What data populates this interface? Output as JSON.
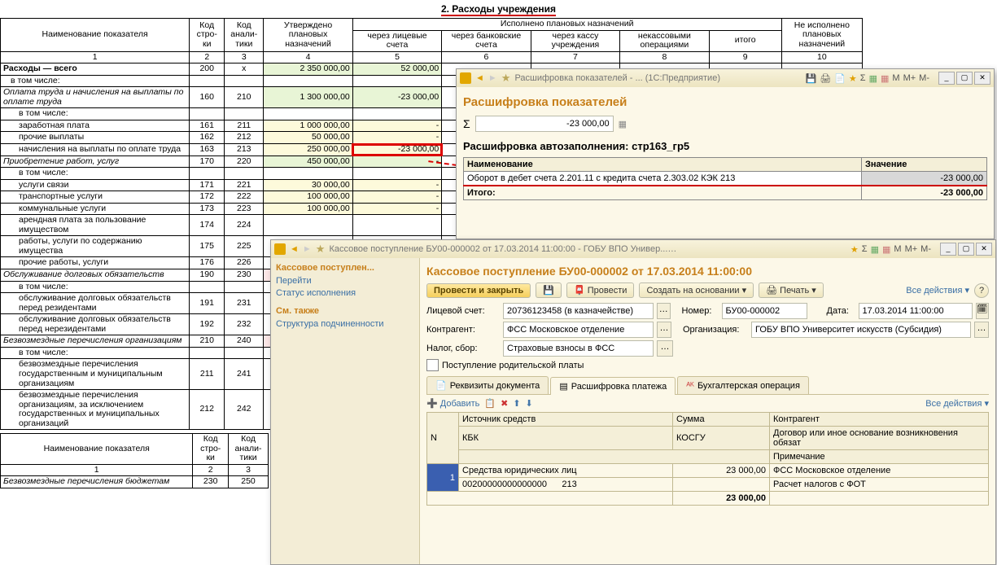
{
  "section_title": "2. Расходы учреждения",
  "headers": {
    "name": "Наименование показателя",
    "row": "Код стро-\nки",
    "anal": "Код анали-\nтики",
    "approved": "Утверждено плановых назначений",
    "exec": "Исполнено плановых назначений",
    "lic": "через лицевые счета",
    "bank": "через банковские счета",
    "kassa": "через кассу учреждения",
    "nekass": "некассовыми операциями",
    "itogo": "итого",
    "notexec": "Не исполнено плановых назначений",
    "num1": "1",
    "num2": "2",
    "num3": "3",
    "num4": "4",
    "num5": "5",
    "num6": "6",
    "num7": "7",
    "num8": "8",
    "num9": "9",
    "num10": "10"
  },
  "rows": [
    {
      "n": "Расходы — всего",
      "bold": true,
      "r": "200",
      "a": "х",
      "c4": "2 350 000,00",
      "c5": "52 000,00",
      "g": true
    },
    {
      "n": "в том числе:",
      "r": "",
      "a": ""
    },
    {
      "n": "Оплата труда и начисления на выплаты по оплате труда",
      "it": true,
      "r": "160",
      "a": "210",
      "c4": "1 300 000,00",
      "c5": "-23 000,00",
      "g": true
    },
    {
      "n": "в том числе:",
      "ind": 1,
      "r": "",
      "a": ""
    },
    {
      "n": "заработная плата",
      "ind": 1,
      "r": "161",
      "a": "211",
      "c4": "1 000 000,00",
      "c5": "-",
      "y": true
    },
    {
      "n": "прочие выплаты",
      "ind": 1,
      "r": "162",
      "a": "212",
      "c4": "50 000,00",
      "c5": "-",
      "y": true
    },
    {
      "n": "начисления на выплаты по оплате труда",
      "ind": 1,
      "r": "163",
      "a": "213",
      "c4": "250 000,00",
      "c5": "-23 000,00",
      "y": true,
      "hl": true
    },
    {
      "n": "Приобретение работ, услуг",
      "it": true,
      "r": "170",
      "a": "220",
      "c4": "450 000,00",
      "c5": "-",
      "g": true
    },
    {
      "n": "в том числе:",
      "ind": 1,
      "r": "",
      "a": ""
    },
    {
      "n": "услуги связи",
      "ind": 1,
      "r": "171",
      "a": "221",
      "c4": "30 000,00",
      "c5": "-",
      "y": true
    },
    {
      "n": "транспортные услуги",
      "ind": 1,
      "r": "172",
      "a": "222",
      "c4": "100 000,00",
      "c5": "-",
      "y": true
    },
    {
      "n": "коммунальные услуги",
      "ind": 1,
      "r": "173",
      "a": "223",
      "c4": "100 000,00",
      "c5": "-",
      "y": true
    },
    {
      "n": "арендная плата за пользование имуществом",
      "ind": 1,
      "r": "174",
      "a": "224"
    },
    {
      "n": "работы, услуги по содержанию имущества",
      "ind": 1,
      "r": "175",
      "a": "225"
    },
    {
      "n": "прочие работы, услуги",
      "ind": 1,
      "r": "176",
      "a": "226"
    },
    {
      "n": "Обслуживание долговых обязательств",
      "it": true,
      "r": "190",
      "a": "230",
      "p": true
    },
    {
      "n": "в том числе:",
      "ind": 1,
      "r": "",
      "a": ""
    },
    {
      "n": "обслуживание долговых обязательств перед резидентами",
      "ind": 1,
      "r": "191",
      "a": "231"
    },
    {
      "n": "обслуживание долговых обязательств перед нерезидентами",
      "ind": 1,
      "r": "192",
      "a": "232"
    },
    {
      "n": "Безвозмездные перечисления организациям",
      "it": true,
      "r": "210",
      "a": "240",
      "p": true
    },
    {
      "n": "в том числе:",
      "ind": 1,
      "r": "",
      "a": ""
    },
    {
      "n": "безвозмездные перечисления государственным и муниципальным организациям",
      "ind": 1,
      "r": "211",
      "a": "241"
    },
    {
      "n": "безвозмездные перечисления организациям, за исключением государственных и муниципальных организаций",
      "ind": 1,
      "r": "212",
      "a": "242"
    }
  ],
  "footer_headers": {
    "name": "Наименование показателя",
    "row": "Код стро-\nки",
    "anal": "Код анали-\nтики",
    "n1": "1",
    "n2": "2",
    "n3": "3"
  },
  "footer_row": {
    "n": "Безвозмездные перечисления бюджетам",
    "r": "230",
    "a": "250"
  },
  "win1": {
    "title": "Расшифровка показателей - ... (1С:Предприятие)",
    "heading": "Расшифровка показателей",
    "sigma_val": "-23 000,00",
    "sub": "Расшифровка автозаполнения: стр163_гр5",
    "col1": "Наименование",
    "col2": "Значение",
    "row1": "Оборот в дебет счета 2.201.11 с кредита счета 2.303.02 КЭК 213",
    "val1": "-23 000,00",
    "itogo": "Итого:",
    "itogo_v": "-23 000,00"
  },
  "win2": {
    "title": "Кассовое поступление БУ00-000002 от 17.03.2014 11:00:00 - ГОБУ ВПО Универ... (1С:Предприятие)",
    "side_hdr": "Кассовое поступлен...",
    "side_links": [
      "Перейти",
      "Статус исполнения"
    ],
    "side_hdr2": "См. также",
    "side_link2": "Структура подчиненности",
    "heading": "Кассовое поступление БУ00-000002 от 17.03.2014 11:00:00",
    "btn_post": "Провести и закрыть",
    "btn_post2": "Провести",
    "btn_create": "Создать на основании",
    "btn_print": "Печать",
    "all_actions": "Все действия",
    "lbl_lic": "Лицевой счет:",
    "val_lic": "20736123458 (в казначействе)",
    "lbl_num": "Номер:",
    "val_num": "БУ00-000002",
    "lbl_date": "Дата:",
    "val_date": "17.03.2014 11:00:00",
    "lbl_контр": "Контрагент:",
    "val_контр": "ФСС Московское отделение",
    "lbl_org": "Организация:",
    "val_org": "ГОБУ ВПО Университет искусств (Субсидия)",
    "lbl_nalog": "Налог, сбор:",
    "val_nalog": "Страховые взносы в ФСС",
    "chk": "Поступление родительской платы",
    "tab1": "Реквизиты документа",
    "tab2": "Расшифровка платежа",
    "tab3": "Бухгалтерская операция",
    "btn_add": "Добавить",
    "th_n": "N",
    "th_src": "Источник средств",
    "th_sum": "Сумма",
    "th_k": "Контрагент",
    "th_kbk": "КБК",
    "th_kosgu": "КОСГУ",
    "th_dog": "Договор или иное основание возникновения обязат",
    "th_prim": "Примечание",
    "r_n": "1",
    "r_src": "Средства юридических лиц",
    "r_sum": "23 000,00",
    "r_k": "ФСС Московское отделение",
    "r_kbk": "00200000000000000",
    "r_kosgu": "213",
    "r_dog": "Расчет налогов с ФОТ",
    "total": "23 000,00"
  },
  "m": {
    "m": "M",
    "mp": "M+",
    "mm": "M-"
  }
}
